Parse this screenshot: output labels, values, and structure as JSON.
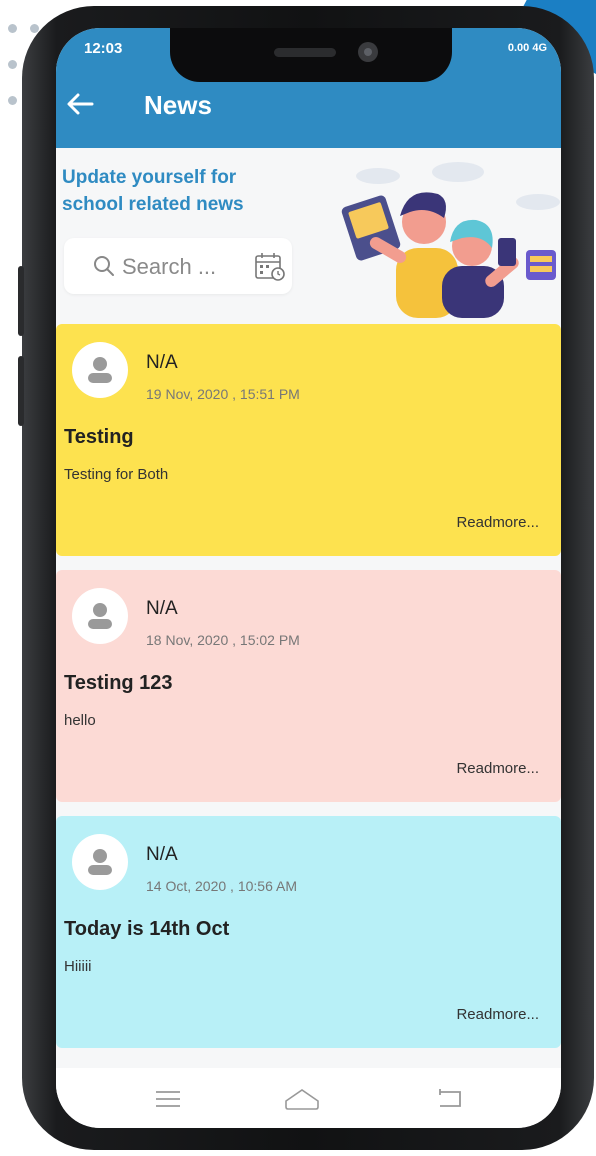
{
  "status": {
    "time": "12:03",
    "right_indicators": "0.00 4G"
  },
  "header": {
    "title": "News"
  },
  "banner": {
    "line1": "Update yourself for",
    "line2": "school related news"
  },
  "search": {
    "placeholder": "Search ..."
  },
  "news": [
    {
      "author": "N/A",
      "date": "19 Nov, 2020 , 15:51 PM",
      "title": "Testing",
      "body": "Testing for Both",
      "readmore": "Readmore...",
      "color": "#fde24f"
    },
    {
      "author": "N/A",
      "date": "18 Nov, 2020 , 15:02 PM",
      "title": "Testing 123",
      "body": "hello",
      "readmore": "Readmore...",
      "color": "#fcdad5"
    },
    {
      "author": "N/A",
      "date": "14 Oct, 2020 , 10:56 AM",
      "title": "Today is 14th Oct",
      "body": "Hiiiii",
      "readmore": "Readmore...",
      "color": "#b8f0f7"
    }
  ],
  "colors": {
    "primary": "#2f8bc2",
    "background": "#f6f7f8"
  },
  "icons": {
    "back": "arrow-left-icon",
    "search": "search-icon",
    "calendar": "calendar-icon",
    "avatar": "user-avatar-icon",
    "nav_menu": "menu-icon",
    "nav_home": "home-icon",
    "nav_back": "back-icon"
  }
}
